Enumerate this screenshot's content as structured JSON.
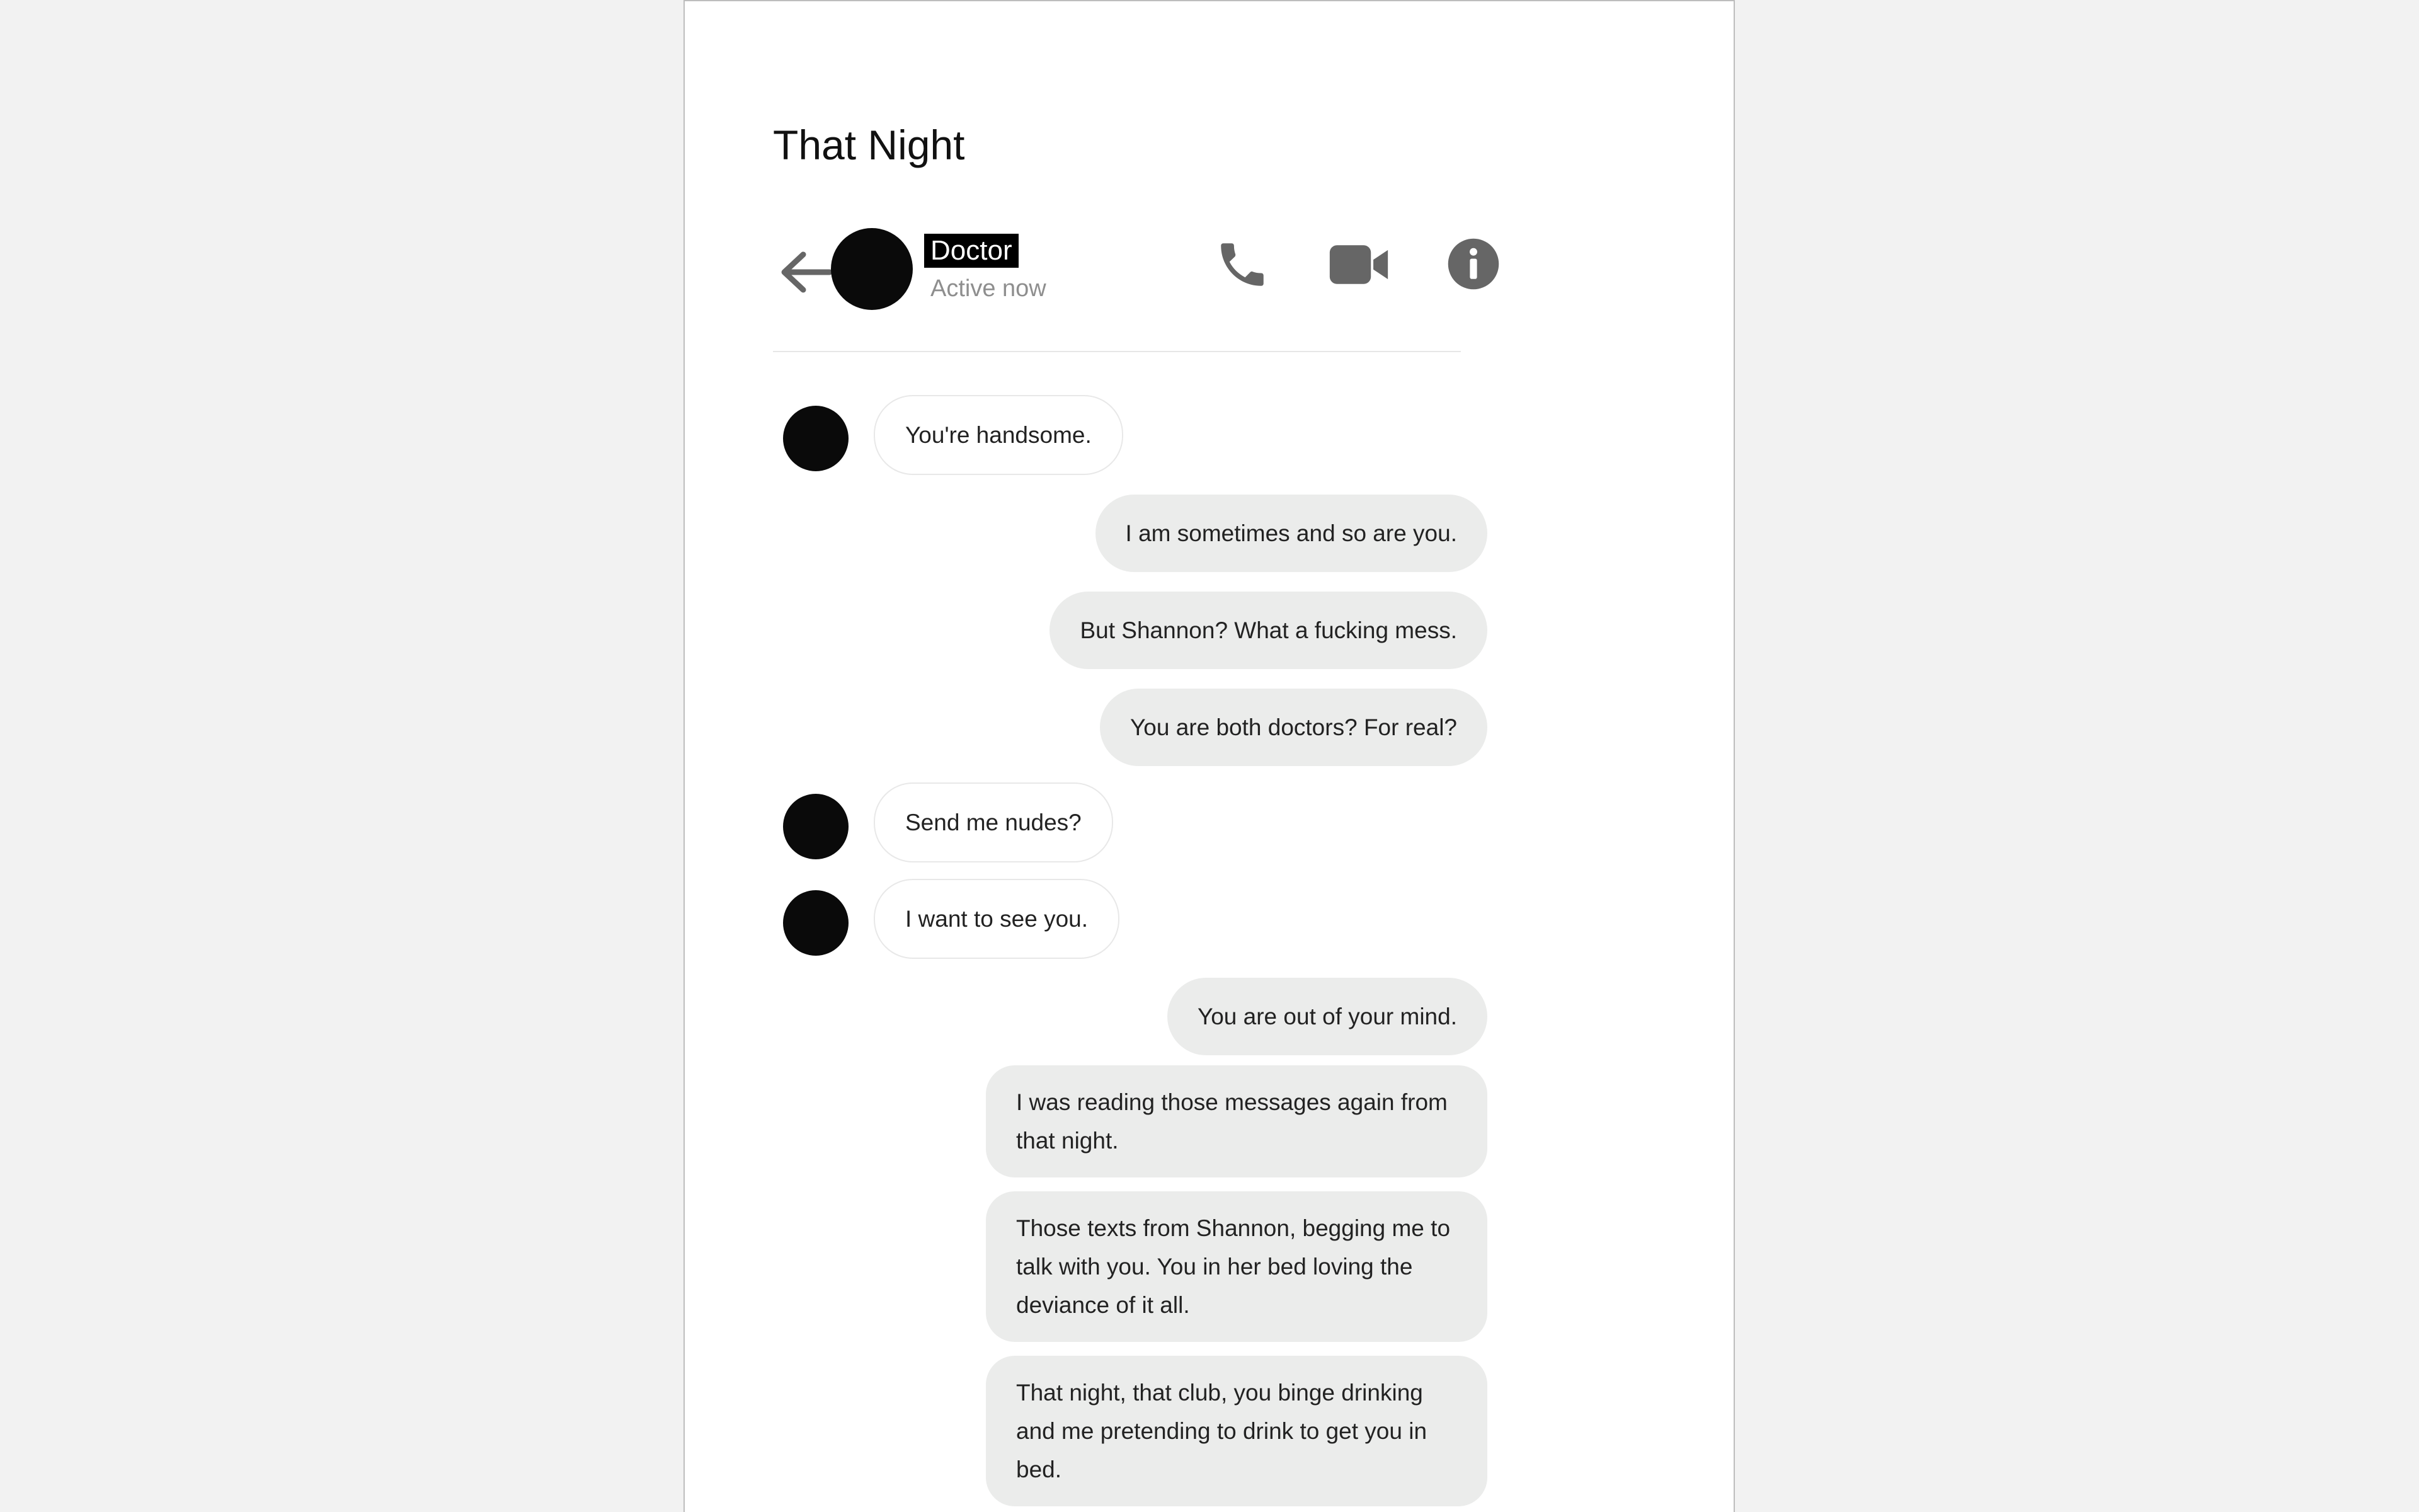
{
  "page": {
    "title": "That Night"
  },
  "header": {
    "back_icon": "arrow-left-icon",
    "contact_name": "Doctor",
    "contact_status": "Active now",
    "call_icon": "phone-icon",
    "video_icon": "video-camera-icon",
    "info_icon": "info-icon"
  },
  "colors": {
    "background": "#f2f2f2",
    "incoming_bubble": "#ffffff",
    "outgoing_bubble": "#ebeceb",
    "icon": "#666666",
    "avatar": "#0a0a0a"
  },
  "messages": [
    {
      "direction": "in",
      "text": "You're handsome."
    },
    {
      "direction": "out",
      "text": "I am sometimes and so are you."
    },
    {
      "direction": "out",
      "text": "But Shannon? What a fucking mess."
    },
    {
      "direction": "out",
      "text": "You are both doctors? For real?"
    },
    {
      "direction": "in",
      "text": "Send me nudes?"
    },
    {
      "direction": "in",
      "text": "I want to see you."
    },
    {
      "direction": "out",
      "text": "You are out of your mind."
    },
    {
      "direction": "out",
      "text": "I was reading those messages again from that night."
    },
    {
      "direction": "out",
      "text": "Those texts from Shannon, begging me to talk with you. You in her bed loving the deviance of it all."
    },
    {
      "direction": "out",
      "text": "That night, that club, you binge drinking and me pretending to drink to get you in bed."
    }
  ]
}
